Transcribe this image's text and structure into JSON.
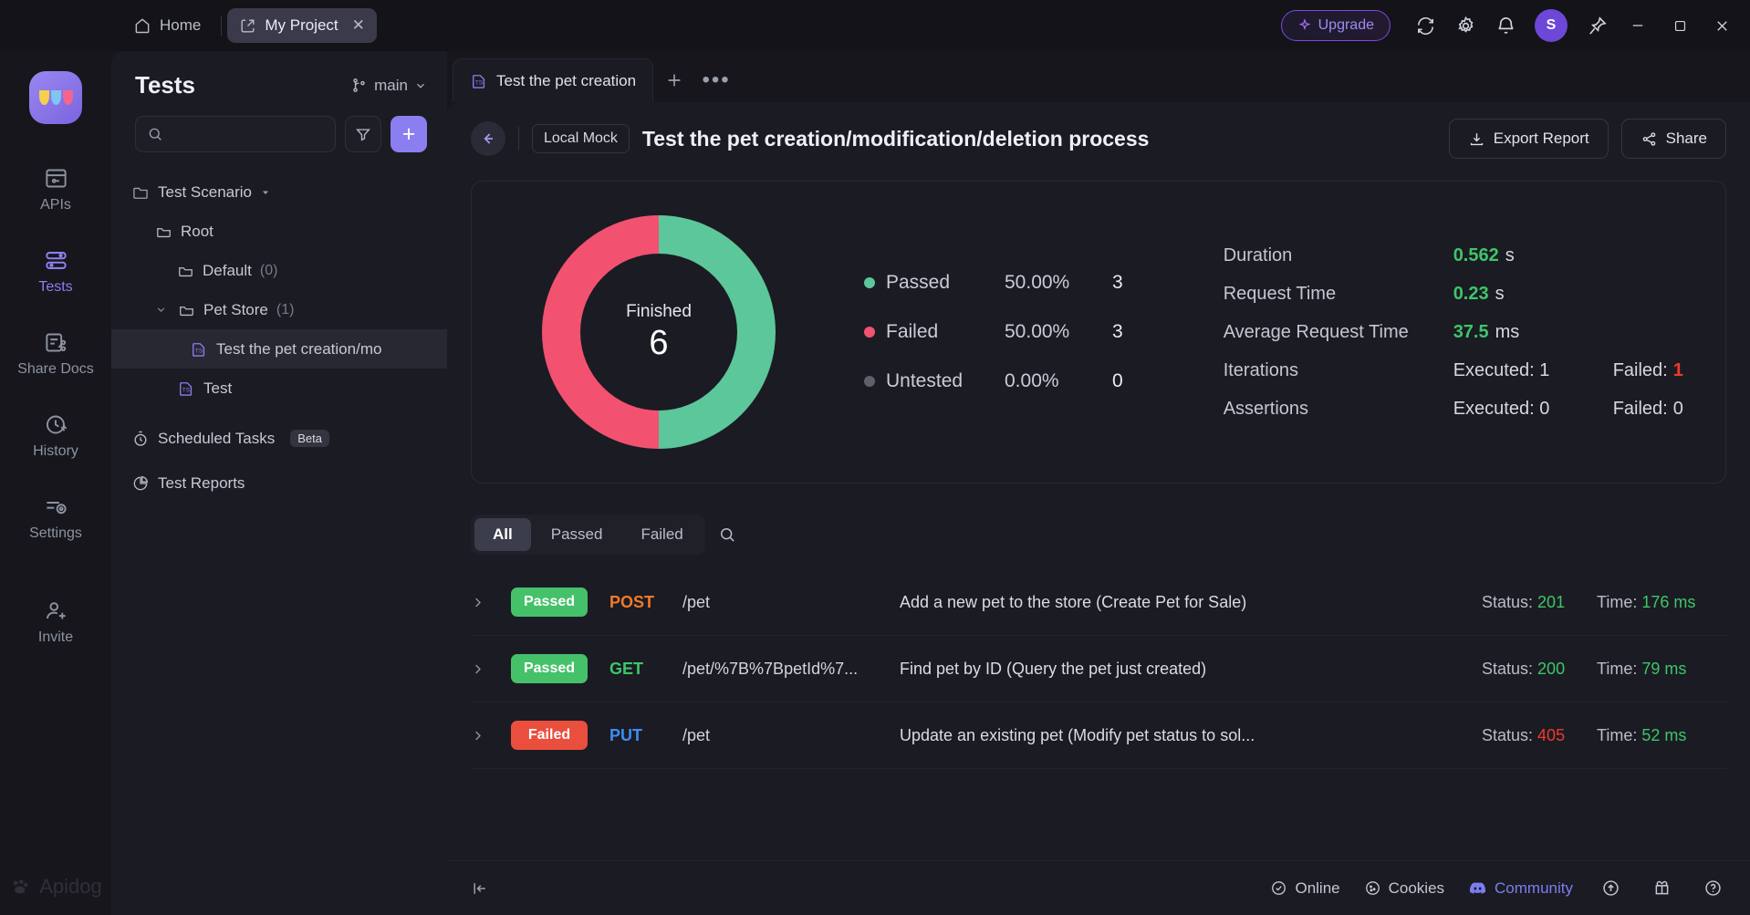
{
  "titlebar": {
    "home_label": "Home",
    "project_tab": "My Project",
    "upgrade_label": "Upgrade",
    "avatar_initial": "S"
  },
  "rail": {
    "items": [
      {
        "label": "APIs",
        "icon": "apis-icon",
        "active": false
      },
      {
        "label": "Tests",
        "icon": "tests-icon",
        "active": true
      },
      {
        "label": "Share Docs",
        "icon": "share-docs-icon",
        "active": false
      },
      {
        "label": "History",
        "icon": "history-icon",
        "active": false
      },
      {
        "label": "Settings",
        "icon": "settings-icon",
        "active": false
      },
      {
        "label": "Invite",
        "icon": "invite-icon",
        "active": false
      }
    ],
    "watermark": "Apidog"
  },
  "panel": {
    "title": "Tests",
    "branch": "main",
    "search_placeholder": "",
    "add_label": "+",
    "tree": {
      "root_label": "Test Scenario",
      "items": [
        {
          "label": "Root",
          "count": "",
          "indent": 1,
          "icon": "folder-icon",
          "selected": false,
          "expanded": null
        },
        {
          "label": "Default",
          "count": "(0)",
          "indent": 2,
          "icon": "folder-icon",
          "selected": false,
          "expanded": null
        },
        {
          "label": "Pet Store",
          "count": "(1)",
          "indent": 2,
          "icon": "folder-icon",
          "selected": false,
          "expanded": true
        },
        {
          "label": "Test the pet creation/mo",
          "count": "",
          "indent": 3,
          "icon": "ts-file-icon",
          "selected": true,
          "expanded": null
        },
        {
          "label": "Test",
          "count": "",
          "indent": 2,
          "icon": "ts-file-icon",
          "selected": false,
          "expanded": null
        }
      ]
    },
    "scheduled_tasks": {
      "label": "Scheduled Tasks",
      "badge": "Beta"
    },
    "test_reports": {
      "label": "Test Reports"
    }
  },
  "main": {
    "tab_label": "Test the pet creation",
    "header": {
      "env": "Local Mock",
      "title": "Test the pet creation/modification/deletion process",
      "export_label": "Export Report",
      "share_label": "Share"
    },
    "summary": {
      "center_label": "Finished",
      "center_value": "6",
      "legend": [
        {
          "name": "Passed",
          "pct": "50.00%",
          "count": "3",
          "color": "#5cc79a"
        },
        {
          "name": "Failed",
          "pct": "50.00%",
          "count": "3",
          "color": "#f2526f"
        },
        {
          "name": "Untested",
          "pct": "0.00%",
          "count": "0",
          "color": "#5d616c"
        }
      ],
      "stats": [
        {
          "key": "Duration",
          "value": "0.562",
          "unit": "s"
        },
        {
          "key": "Request Time",
          "value": "0.23",
          "unit": "s"
        },
        {
          "key": "Average Request Time",
          "value": "37.5",
          "unit": "ms"
        }
      ],
      "counters": [
        {
          "key": "Iterations",
          "executed": "Executed: 1",
          "failed_label": "Failed:",
          "failed_value": "1",
          "failed_bad": true
        },
        {
          "key": "Assertions",
          "executed": "Executed: 0",
          "failed_label": "Failed:",
          "failed_value": "0",
          "failed_bad": false
        }
      ]
    },
    "filters": {
      "tabs": [
        "All",
        "Passed",
        "Failed"
      ],
      "active": "All"
    },
    "results": [
      {
        "status": "Passed",
        "method": "POST",
        "path": "/pet",
        "desc": "Add a new pet to the store (Create Pet for Sale)",
        "status_label": "Status:",
        "status_code": "201",
        "time_label": "Time:",
        "time_value": "176 ms"
      },
      {
        "status": "Passed",
        "method": "GET",
        "path": "/pet/%7B%7BpetId%7...",
        "desc": "Find pet by ID (Query the pet just created)",
        "status_label": "Status:",
        "status_code": "200",
        "time_label": "Time:",
        "time_value": "79 ms"
      },
      {
        "status": "Failed",
        "method": "PUT",
        "path": "/pet",
        "desc": "Update an existing pet (Modify pet status to sol...",
        "status_label": "Status:",
        "status_code": "405",
        "time_label": "Time:",
        "time_value": "52 ms"
      }
    ]
  },
  "statusbar": {
    "items": [
      {
        "label": "Online",
        "icon": "check-circle-icon"
      },
      {
        "label": "Cookies",
        "icon": "cookie-icon"
      },
      {
        "label": "Community",
        "icon": "discord-icon"
      }
    ]
  },
  "chart_data": {
    "type": "pie",
    "title": "Finished",
    "categories": [
      "Passed",
      "Failed",
      "Untested"
    ],
    "values": [
      3,
      3,
      0
    ],
    "percentages": [
      50.0,
      50.0,
      0.0
    ],
    "colors": [
      "#5cc79a",
      "#f2526f",
      "#5d616c"
    ],
    "total": 6,
    "legend_position": "right",
    "donut": true
  }
}
